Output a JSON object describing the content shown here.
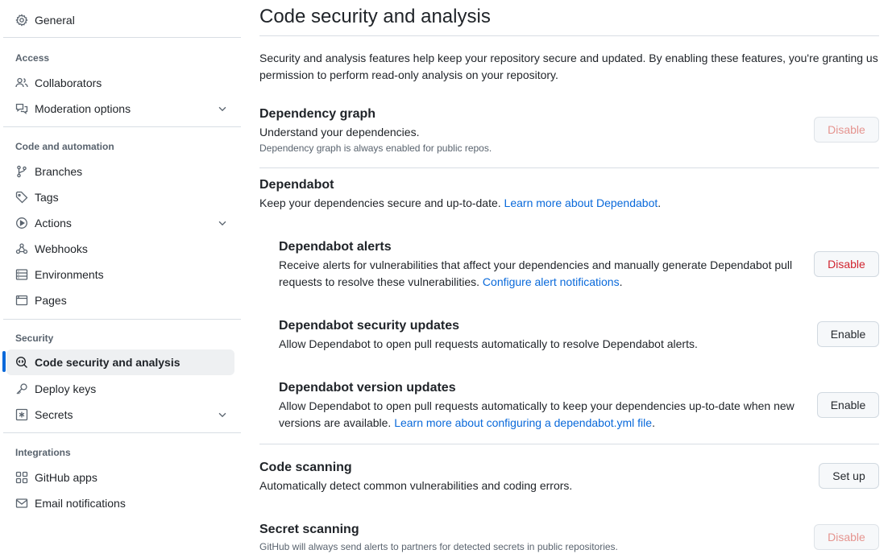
{
  "sidebar": {
    "general": "General",
    "sections": {
      "access": "Access",
      "code_automation": "Code and automation",
      "security": "Security",
      "integrations": "Integrations"
    },
    "items": {
      "collaborators": "Collaborators",
      "moderation": "Moderation options",
      "branches": "Branches",
      "tags": "Tags",
      "actions": "Actions",
      "webhooks": "Webhooks",
      "environments": "Environments",
      "pages": "Pages",
      "code_security": "Code security and analysis",
      "deploy_keys": "Deploy keys",
      "secrets": "Secrets",
      "github_apps": "GitHub apps",
      "email_notifications": "Email notifications"
    },
    "active_item": "Code security and analysis"
  },
  "main": {
    "title": "Code security and analysis",
    "intro_line1": "Security and analysis features help keep your repository secure and updated. By enabling these features, you're granting us",
    "intro_line2": "permission to perform read-only analysis on your repository.",
    "dependency_graph": {
      "title": "Dependency graph",
      "description": "Understand your dependencies.",
      "note": "Dependency graph is always enabled for public repos.",
      "button": "Disable"
    },
    "dependabot": {
      "title": "Dependabot",
      "description": "Keep your dependencies secure and up-to-date.",
      "link": "Learn more about Dependabot",
      "link_suffix": "."
    },
    "dependabot_alerts": {
      "title": "Dependabot alerts",
      "line1": "Receive alerts for vulnerabilities that affect your dependencies and manually generate Dependabot pull",
      "line2": "requests to resolve these vulnerabilities.",
      "link": "Configure alert notifications",
      "link_suffix": ".",
      "button": "Disable"
    },
    "dependabot_security": {
      "title": "Dependabot security updates",
      "description": "Allow Dependabot to open pull requests automatically to resolve Dependabot alerts.",
      "button": "Enable"
    },
    "dependabot_version": {
      "title": "Dependabot version updates",
      "line1": "Allow Dependabot to open pull requests automatically to keep your dependencies up-to-date when new",
      "line2": "versions are available.",
      "link": "Learn more about configuring a dependabot.yml file",
      "link_suffix": ".",
      "button": "Enable"
    },
    "code_scanning": {
      "title": "Code scanning",
      "description": "Automatically detect common vulnerabilities and coding errors.",
      "button": "Set up"
    },
    "secret_scanning": {
      "title": "Secret scanning",
      "note": "GitHub will always send alerts to partners for detected secrets in public repositories.",
      "button": "Disable"
    }
  },
  "colors": {
    "accent": "#0969da",
    "danger": "#d1242f",
    "border": "#d1d9e0",
    "muted": "#59636e"
  },
  "icons": {
    "general": "gear-icon",
    "collaborators": "people-icon",
    "moderation": "comment-discussion-icon",
    "branches": "git-branch-icon",
    "tags": "tag-icon",
    "actions": "play-icon",
    "webhooks": "webhook-icon",
    "environments": "server-icon",
    "pages": "browser-icon",
    "code_security": "codescan-icon",
    "deploy_keys": "key-icon",
    "secrets": "key-asterisk-icon",
    "github_apps": "apps-icon",
    "email_notifications": "mail-icon"
  }
}
